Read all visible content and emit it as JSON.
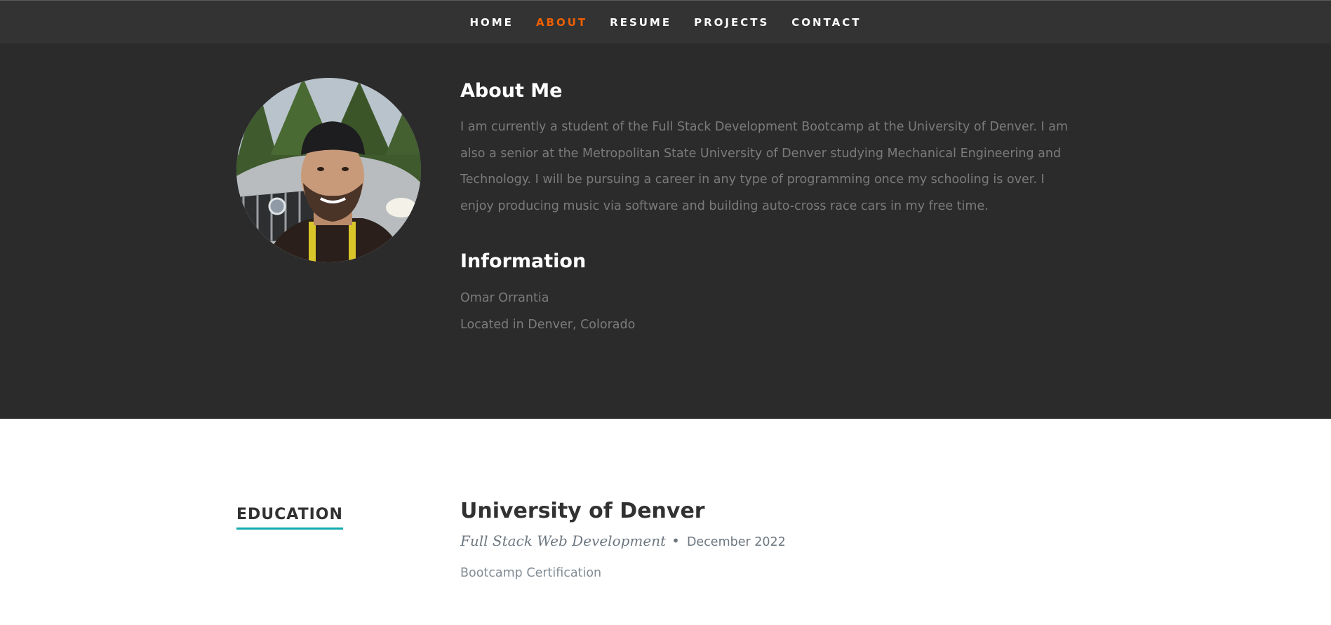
{
  "nav": {
    "items": [
      {
        "label": "HOME",
        "active": false
      },
      {
        "label": "ABOUT",
        "active": true
      },
      {
        "label": "RESUME",
        "active": false
      },
      {
        "label": "PROJECTS",
        "active": false
      },
      {
        "label": "CONTACT",
        "active": false
      }
    ],
    "active_color": "#f06000"
  },
  "about": {
    "heading": "About Me",
    "text": "I am currently a student of the Full Stack Development Bootcamp at the University of Denver. I am also a senior at the Metropolitan State University of Denver studying Mechanical Engineering and Technology. I will be pursuing a career in any type of programming once my schooling is over. I enjoy producing music via software and building auto-cross race cars in my free time.",
    "info_heading": "Information",
    "name": "Omar Orrantia",
    "location": "Located in Denver, Colorado"
  },
  "education": {
    "label": "EDUCATION",
    "accent_color": "#11abb0",
    "school": "University of Denver",
    "degree": "Full Stack Web Development",
    "bullet": "•",
    "date": "December 2022",
    "description": "Bootcamp Certification"
  }
}
